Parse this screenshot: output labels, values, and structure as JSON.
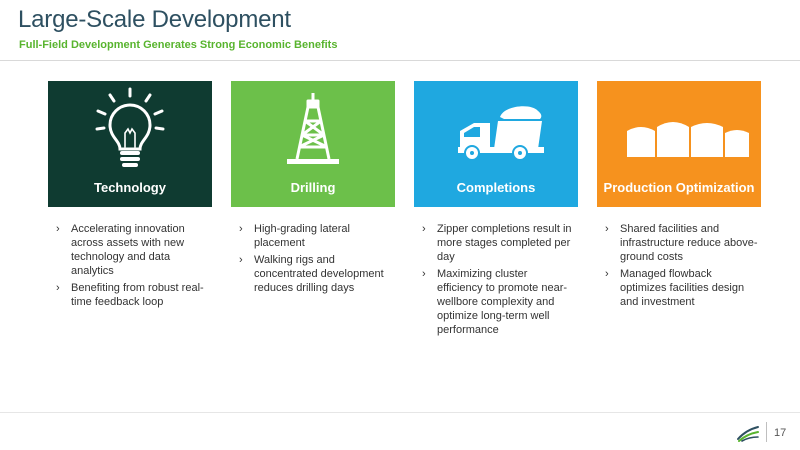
{
  "header": {
    "title": "Large-Scale Development",
    "subtitle": "Full-Field Development Generates Strong Economic Benefits"
  },
  "columns": [
    {
      "label": "Technology",
      "icon": "lightbulb-icon",
      "color": "#0f3b31",
      "bullets": [
        "Accelerating innovation across assets with new technology and data analytics",
        "Benefiting from robust real-time feedback loop"
      ]
    },
    {
      "label": "Drilling",
      "icon": "drilling-rig-icon",
      "color": "#6cc04a",
      "bullets": [
        "High-grading lateral placement",
        "Walking rigs and concentrated development reduces drilling days"
      ]
    },
    {
      "label": "Completions",
      "icon": "sand-truck-icon",
      "color": "#1fa8e0",
      "bullets": [
        "Zipper completions result in more stages completed per day",
        "Maximizing cluster efficiency to promote near-wellbore complexity and optimize long-term well performance"
      ]
    },
    {
      "label": "Production Optimization",
      "icon": "storage-tanks-icon",
      "color": "#f6921e",
      "bullets": [
        "Shared facilities and infrastructure reduce above-ground costs",
        "Managed flowback optimizes facilities design and investment"
      ]
    }
  ],
  "bullet_marker": "›",
  "footer": {
    "page_number": "17",
    "logo_icon": "company-logo-icon"
  }
}
